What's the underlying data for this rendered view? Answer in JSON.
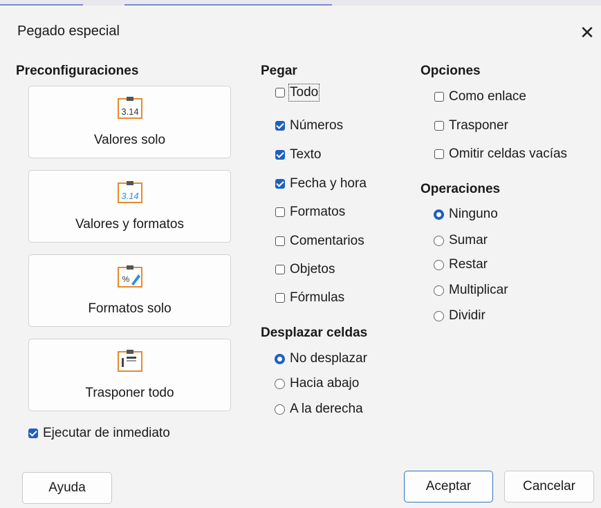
{
  "dialog": {
    "title": "Pegado especial",
    "close_icon": "close-icon"
  },
  "presets": {
    "heading": "Preconfiguraciones",
    "items": [
      {
        "label": "Valores solo",
        "icon": "values-only-icon"
      },
      {
        "label": "Valores y formatos",
        "icon": "values-formats-icon"
      },
      {
        "label": "Formatos solo",
        "icon": "formats-only-icon"
      },
      {
        "label": "Trasponer todo",
        "icon": "transpose-all-icon"
      }
    ],
    "run_immediately": {
      "label": "Ejecutar de inmediato",
      "checked": true
    }
  },
  "paste": {
    "heading": "Pegar",
    "items": [
      {
        "label": "Todo",
        "checked": false
      },
      {
        "label": "Números",
        "checked": true
      },
      {
        "label": "Texto",
        "checked": true
      },
      {
        "label": "Fecha y hora",
        "checked": true
      },
      {
        "label": "Formatos",
        "checked": false
      },
      {
        "label": "Comentarios",
        "checked": false
      },
      {
        "label": "Objetos",
        "checked": false
      },
      {
        "label": "Fórmulas",
        "checked": false
      }
    ]
  },
  "shift_cells": {
    "heading": "Desplazar celdas",
    "items": [
      {
        "label": "No desplazar",
        "selected": true
      },
      {
        "label": "Hacia abajo",
        "selected": false
      },
      {
        "label": "A la derecha",
        "selected": false
      }
    ]
  },
  "options": {
    "heading": "Opciones",
    "items": [
      {
        "label": "Como enlace",
        "checked": false
      },
      {
        "label": "Trasponer",
        "checked": false
      },
      {
        "label": "Omitir celdas vacías",
        "checked": false
      }
    ]
  },
  "operations": {
    "heading": "Operaciones",
    "items": [
      {
        "label": "Ninguno",
        "selected": true
      },
      {
        "label": "Sumar",
        "selected": false
      },
      {
        "label": "Restar",
        "selected": false
      },
      {
        "label": "Multiplicar",
        "selected": false
      },
      {
        "label": "Dividir",
        "selected": false
      }
    ]
  },
  "buttons": {
    "help": "Ayuda",
    "ok": "Aceptar",
    "cancel": "Cancelar"
  },
  "colors": {
    "accent": "#1f5fbf",
    "icon_orange": "#e8892f",
    "icon_blue": "#2b8fd6"
  }
}
